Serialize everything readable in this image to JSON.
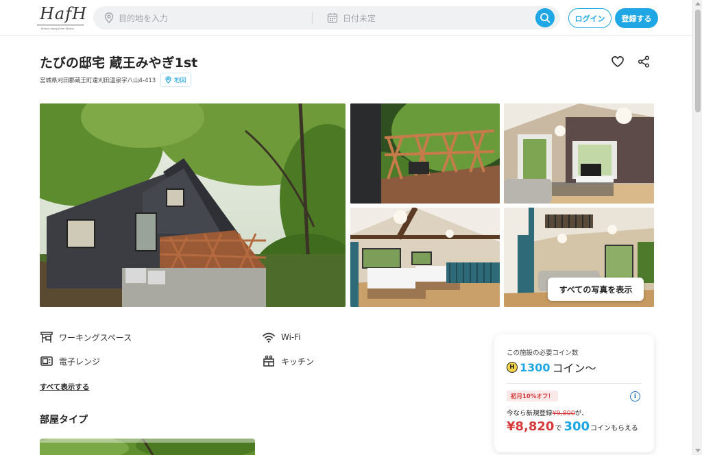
{
  "header": {
    "logo_text": "HafH",
    "logo_tagline": "Home away from Home",
    "search_placeholder": "目的地を入力",
    "date_placeholder": "日付未定",
    "login_label": "ログイン",
    "register_label": "登録する"
  },
  "listing": {
    "title": "たびの邸宅 蔵王みやぎ1st",
    "address": "宮城県刈田郡蔵王町遠刈田温泉字八山4-413",
    "map_label": "地図"
  },
  "gallery": {
    "show_all_label": "すべての写真を表示"
  },
  "amenities": {
    "items": [
      {
        "label": "ワーキングスペース",
        "icon": "workspace-icon"
      },
      {
        "label": "Wi-Fi",
        "icon": "wifi-icon"
      },
      {
        "label": "電子レンジ",
        "icon": "microwave-icon"
      },
      {
        "label": "キッチン",
        "icon": "kitchen-icon"
      }
    ],
    "show_more_label": "すべて表示する"
  },
  "room_types": {
    "title": "部屋タイプ"
  },
  "price_card": {
    "label": "この施設の必要コイン数",
    "coin_symbol": "H",
    "coin_amount": "1300",
    "coin_suffix": "コイン〜",
    "promo_badge": "初月10%オフ！",
    "promo_prefix": "今なら新規登録",
    "promo_original": "¥9,800",
    "promo_suffix": "が、",
    "promo_price": "¥8,820",
    "promo_te": "で",
    "promo_coins": "300",
    "promo_coins_suffix": "コインもらえる"
  },
  "colors": {
    "accent": "#1ea7e4",
    "promo_red": "#d83b3b",
    "coin_yellow": "#f7d34a"
  }
}
